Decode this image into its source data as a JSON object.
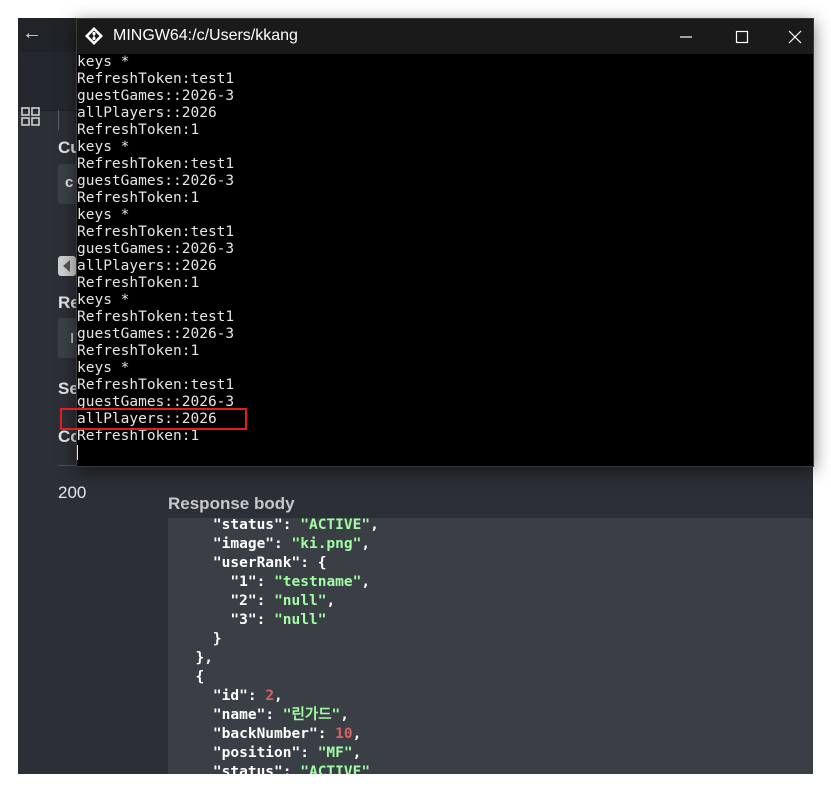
{
  "app": {
    "back_icon": "arrow-left-icon",
    "apps_icon": "grid-icon"
  },
  "swagger_fragments": {
    "section1": "Cu",
    "field1": "c",
    "section2": "Re",
    "field2": "I",
    "section3": "Se",
    "section4": "Co"
  },
  "response": {
    "code": "200",
    "body_label": "Response body",
    "lines": [
      {
        "indent": "    ",
        "key": "\"status\"",
        "sep": ": ",
        "value": "\"ACTIVE\"",
        "type": "str",
        "end": ","
      },
      {
        "indent": "    ",
        "key": "\"image\"",
        "sep": ": ",
        "value": "\"ki.png\"",
        "type": "str",
        "end": ","
      },
      {
        "indent": "    ",
        "key": "\"userRank\"",
        "sep": ": ",
        "value": "{",
        "type": "punc",
        "end": ""
      },
      {
        "indent": "      ",
        "key": "\"1\"",
        "sep": ": ",
        "value": "\"testname\"",
        "type": "str",
        "end": ","
      },
      {
        "indent": "      ",
        "key": "\"2\"",
        "sep": ": ",
        "value": "\"null\"",
        "type": "str",
        "end": ","
      },
      {
        "indent": "      ",
        "key": "\"3\"",
        "sep": ": ",
        "value": "\"null\"",
        "type": "str",
        "end": ""
      },
      {
        "indent": "    ",
        "key": "",
        "sep": "",
        "value": "}",
        "type": "punc",
        "end": ""
      },
      {
        "indent": "  ",
        "key": "",
        "sep": "",
        "value": "},",
        "type": "punc",
        "end": ""
      },
      {
        "indent": "  ",
        "key": "",
        "sep": "",
        "value": "{",
        "type": "punc",
        "end": ""
      },
      {
        "indent": "    ",
        "key": "\"id\"",
        "sep": ": ",
        "value": "2",
        "type": "num",
        "end": ","
      },
      {
        "indent": "    ",
        "key": "\"name\"",
        "sep": ": ",
        "value": "\"린가드\"",
        "type": "str",
        "end": ","
      },
      {
        "indent": "    ",
        "key": "\"backNumber\"",
        "sep": ": ",
        "value": "10",
        "type": "num",
        "end": ","
      },
      {
        "indent": "    ",
        "key": "\"position\"",
        "sep": ": ",
        "value": "\"MF\"",
        "type": "str",
        "end": ","
      },
      {
        "indent": "    ",
        "key": "\"status\"",
        "sep": ": ",
        "value": "\"ACTIVE\"",
        "type": "str",
        "end": ""
      }
    ]
  },
  "terminal": {
    "title": "MINGW64:/c/Users/kkang",
    "icon": "git-bash-icon",
    "minimize_icon": "minimize-icon",
    "maximize_icon": "maximize-icon",
    "close_icon": "close-icon",
    "highlighted_line": "allPlayers::2026",
    "lines": [
      "keys *",
      "RefreshToken:test1",
      "guestGames::2026-3",
      "allPlayers::2026",
      "RefreshToken:1",
      "keys *",
      "RefreshToken:test1",
      "guestGames::2026-3",
      "RefreshToken:1",
      "keys *",
      "RefreshToken:test1",
      "guestGames::2026-3",
      "allPlayers::2026",
      "RefreshToken:1",
      "keys *",
      "RefreshToken:test1",
      "guestGames::2026-3",
      "RefreshToken:1",
      "keys *",
      "RefreshToken:test1",
      "guestGames::2026-3",
      "allPlayers::2026",
      "RefreshToken:1"
    ]
  },
  "colors": {
    "highlight_border": "#e02020",
    "json_string": "#a2fca2",
    "json_number": "#d36363"
  }
}
